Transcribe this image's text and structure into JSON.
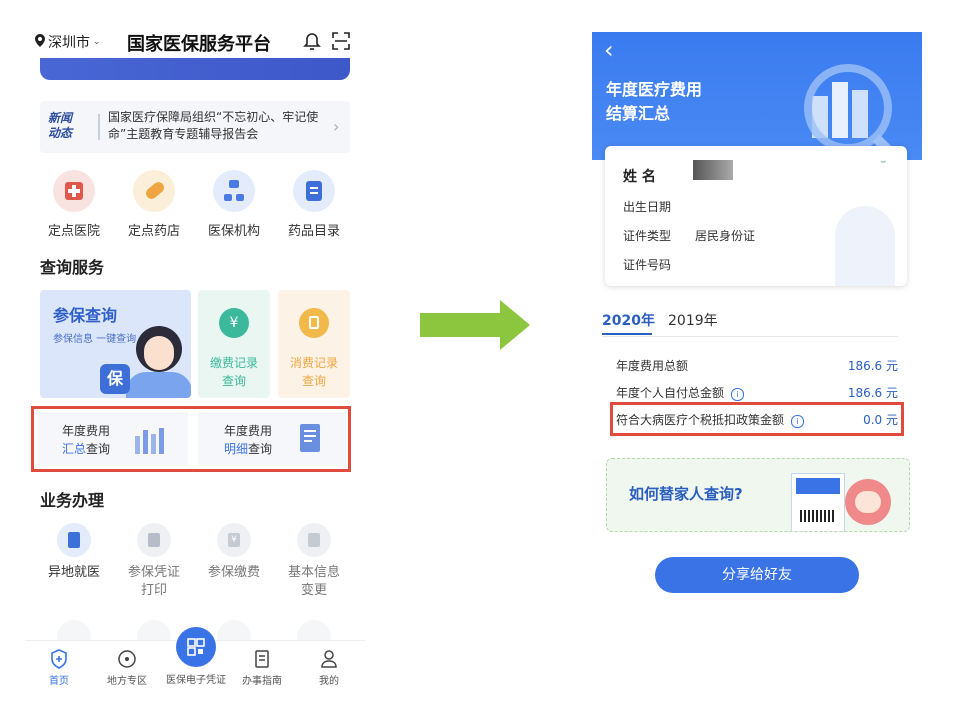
{
  "left": {
    "location": "深圳市",
    "app_title": "国家医保服务平台",
    "news": {
      "tag_line1": "新闻",
      "tag_line2": "动态",
      "text": "国家医疗保障局组织“不忘初心、牢记使命”主题教育专题辅导报告会"
    },
    "quick": [
      {
        "label": "定点医院",
        "color": "#f9e3e1",
        "fg": "#e0574b"
      },
      {
        "label": "定点药店",
        "color": "#fbefd9",
        "fg": "#f0a640"
      },
      {
        "label": "医保机构",
        "color": "#e4ecfb",
        "fg": "#4a7be0"
      },
      {
        "label": "药品目录",
        "color": "#e4ecfb",
        "fg": "#3c6fd8"
      }
    ],
    "query_section": "查询服务",
    "insurance_query": {
      "title": "参保查询",
      "subtitle": "参保信息 一键查询",
      "badge": "保"
    },
    "payment_records": {
      "line1": "缴费记录",
      "line2": "查询"
    },
    "consume_records": {
      "line1": "消费记录",
      "line2": "查询"
    },
    "annual_summary": {
      "line1": "年度费用",
      "highlight": "汇总",
      "suffix": "查询"
    },
    "annual_detail": {
      "line1": "年度费用",
      "highlight": "明细",
      "suffix": "查询"
    },
    "biz_section": "业务办理",
    "biz": [
      {
        "line1": "异地就医",
        "line2": "",
        "active": true
      },
      {
        "line1": "参保凭证",
        "line2": "打印",
        "active": false
      },
      {
        "line1": "参保缴费",
        "line2": "",
        "active": false
      },
      {
        "line1": "基本信息",
        "line2": "变更",
        "active": false
      }
    ],
    "tabs": [
      {
        "label": "首页",
        "active": true
      },
      {
        "label": "地方专区",
        "active": false
      },
      {
        "label": "医保电子凭证",
        "active": false
      },
      {
        "label": "办事指南",
        "active": false
      },
      {
        "label": "我的",
        "active": false
      }
    ]
  },
  "right": {
    "back": "‹",
    "title_line1": "年度医疗费用",
    "title_line2": "结算汇总",
    "card": {
      "name_label": "姓 名",
      "birth_label": "出生日期",
      "id_type_label": "证件类型",
      "id_type_value": "居民身份证",
      "id_no_label": "证件号码"
    },
    "years": [
      {
        "label": "2020年",
        "active": true
      },
      {
        "label": "2019年",
        "active": false
      }
    ],
    "fees": [
      {
        "label": "年度费用总额",
        "value": "186.6 元",
        "info": false
      },
      {
        "label": "年度个人自付总金额",
        "value": "186.6 元",
        "info": true
      },
      {
        "label": "符合大病医疗个税抵扣政策金额",
        "value": "0.0 元",
        "info": true
      }
    ],
    "family_banner": "如何替家人查询?",
    "share_button": "分享给好友"
  },
  "colors": {
    "accent": "#3a73e6",
    "highlight_box": "#e04b3c",
    "arrow": "#8cc63f"
  }
}
